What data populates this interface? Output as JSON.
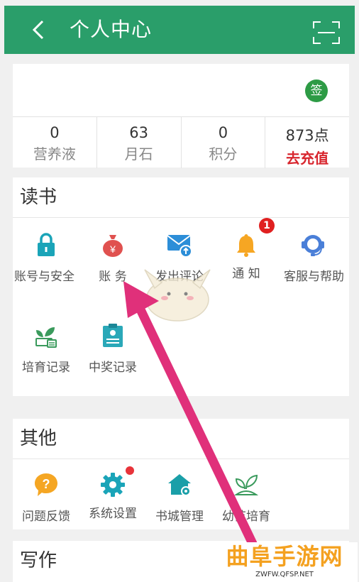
{
  "header": {
    "title": "个人中心"
  },
  "profile": {
    "sign_label": "签",
    "stats": [
      {
        "value": "0",
        "label": "营养液"
      },
      {
        "value": "63",
        "label": "月石"
      },
      {
        "value": "0",
        "label": "积分"
      },
      {
        "value": "873点",
        "label": "去充值"
      }
    ]
  },
  "reading": {
    "title": "读书",
    "items": [
      {
        "label": "账号与安全",
        "icon": "lock-icon"
      },
      {
        "label": "账 务",
        "icon": "money-bag-icon"
      },
      {
        "label": "发出评论",
        "icon": "mail-upload-icon"
      },
      {
        "label": "通 知",
        "icon": "bell-icon",
        "badge": "1"
      },
      {
        "label": "客服与帮助",
        "icon": "headset-icon"
      },
      {
        "label": "培育记录",
        "icon": "sprout-record-icon"
      },
      {
        "label": "中奖记录",
        "icon": "prize-record-icon"
      }
    ]
  },
  "others": {
    "title": "其他",
    "items": [
      {
        "label": "问题反馈",
        "icon": "question-icon"
      },
      {
        "label": "系统设置",
        "icon": "gear-icon"
      },
      {
        "label": "书城管理",
        "icon": "house-gear-icon"
      },
      {
        "label": "幼苗培育",
        "icon": "seedling-icon"
      }
    ]
  },
  "writing": {
    "title": "写作"
  },
  "watermark": {
    "main": "曲阜手游网",
    "sub": "ZWFW.QFSP.NET"
  },
  "colors": {
    "header": "#2a9e6a",
    "accent_red": "#d8262e",
    "arrow": "#e0307a"
  }
}
